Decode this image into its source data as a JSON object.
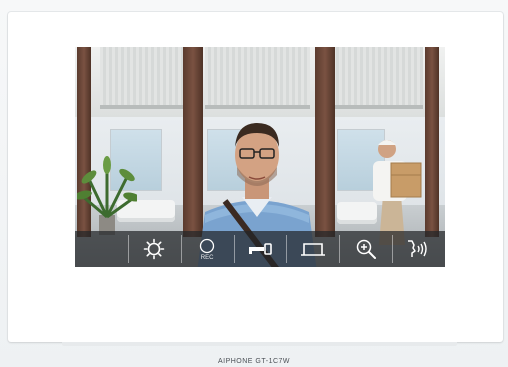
{
  "screen": {
    "toolbar": {
      "buttons": [
        {
          "name": "empty",
          "icon": "none"
        },
        {
          "name": "settings",
          "icon": "sun-gear-icon"
        },
        {
          "name": "record",
          "icon": "record-circle-icon",
          "label": "REC"
        },
        {
          "name": "door-lock",
          "icon": "key-icon"
        },
        {
          "name": "gate",
          "icon": "gate-icon"
        },
        {
          "name": "zoom",
          "icon": "zoom-in-icon"
        },
        {
          "name": "talk",
          "icon": "speak-icon"
        }
      ]
    }
  },
  "device": {
    "brand": "AIPHONE  GT-1C7W"
  },
  "colors": {
    "toolbar_bg": "#222628",
    "icon": "#ffffff",
    "device_body": "#ffffff"
  }
}
